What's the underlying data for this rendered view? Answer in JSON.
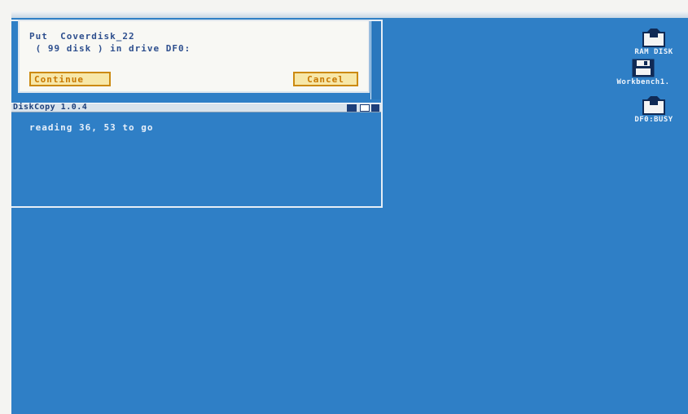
{
  "requester": {
    "line1": "Put  Coverdisk_22",
    "line2": " ( 99 disk ) in drive DF0:",
    "continue_label": "Continue",
    "cancel_label": "Cancel"
  },
  "shell": {
    "title": "DiskCopy 1.0.4",
    "status": "reading 36, 53 to go"
  },
  "desktop_icons": [
    {
      "label": "RAM DISK",
      "icon": "ram-disk-icon"
    },
    {
      "label": "Workbench1.",
      "icon": "workbench-disk-icon"
    },
    {
      "label": "DF0:BUSY",
      "icon": "floppy-disk-icon"
    }
  ],
  "colors": {
    "desktop": "#2f7fc6",
    "requester_bg": "#f8f8f4",
    "text_blue": "#2e4f8e",
    "button_border": "#cc8a10",
    "button_fill": "#f7e7a8"
  }
}
